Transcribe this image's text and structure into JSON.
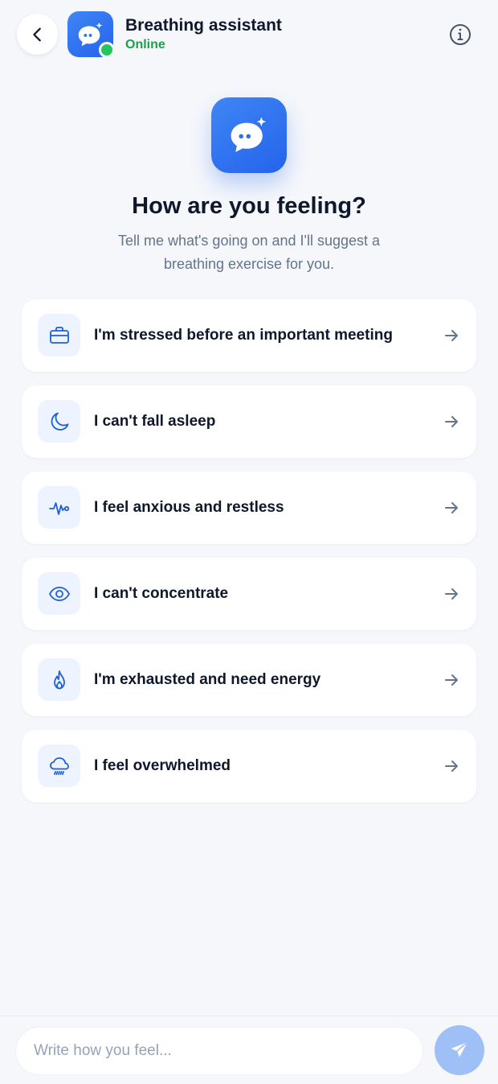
{
  "header": {
    "back_icon": "chevron-left-icon",
    "avatar_icon": "chat-sparkle-icon",
    "title": "Breathing assistant",
    "status": "Online",
    "info_icon": "info-icon"
  },
  "hero": {
    "icon": "chat-sparkle-icon",
    "title": "How are you feeling?",
    "subtitle": "Tell me what's going on and I'll suggest a breathing exercise for you."
  },
  "options": [
    {
      "icon": "briefcase-icon",
      "label": "I'm stressed before an important meeting"
    },
    {
      "icon": "moon-icon",
      "label": "I can't fall asleep"
    },
    {
      "icon": "pulse-icon",
      "label": "I feel anxious and restless"
    },
    {
      "icon": "eye-icon",
      "label": "I can't concentrate"
    },
    {
      "icon": "flame-icon",
      "label": "I'm exhausted and need energy"
    },
    {
      "icon": "cloud-rain-icon",
      "label": "I feel overwhelmed"
    }
  ],
  "composer": {
    "placeholder": "Write how you feel...",
    "value": "",
    "send_icon": "send-icon"
  },
  "colors": {
    "accent": "#2563eb",
    "online": "#22c55e",
    "background": "#f5f7fb",
    "send_disabled": "#9ec0f6"
  }
}
